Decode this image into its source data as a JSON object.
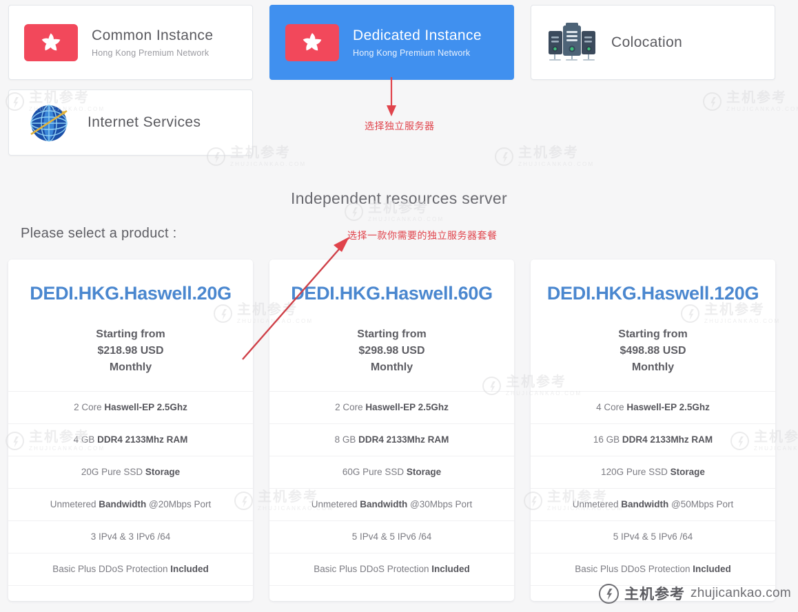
{
  "categories": {
    "row1": [
      {
        "title": "Common Instance",
        "subtitle": "Hong Kong Premium Network",
        "icon": "hong-kong-flag-icon",
        "selected": false
      },
      {
        "title": "Dedicated Instance",
        "subtitle": "Hong Kong Premium Network",
        "icon": "hong-kong-flag-icon",
        "selected": true
      },
      {
        "title": "Colocation",
        "subtitle": "",
        "icon": "server-rack-icon",
        "selected": false
      }
    ],
    "row2": [
      {
        "title": "Internet Services",
        "subtitle": "",
        "icon": "globe-icon",
        "selected": false
      }
    ]
  },
  "annotations": [
    {
      "text": "选择独立服务器",
      "kind": "arrow-down-annotation"
    },
    {
      "text": "选择一款你需要的独立服务器套餐",
      "kind": "arrow-diagonal-annotation"
    }
  ],
  "section_title": "Independent resources server",
  "select_label": "Please select a product :",
  "products": [
    {
      "name": "DEDI.HKG.Haswell.20G",
      "price_prefix": "Starting from",
      "price": "$218.98 USD",
      "price_period": "Monthly",
      "specs": [
        {
          "plain": "2 Core ",
          "bold": "Haswell-EP 2.5Ghz",
          "tail": ""
        },
        {
          "plain": "4 GB ",
          "bold": "DDR4 2133Mhz RAM",
          "tail": ""
        },
        {
          "plain": "20G Pure SSD ",
          "bold": "Storage",
          "tail": ""
        },
        {
          "plain": "Unmetered ",
          "bold": "Bandwidth",
          "tail": " @20Mbps Port"
        },
        {
          "plain": "3 IPv4 & 3 IPv6 /64",
          "bold": "",
          "tail": ""
        },
        {
          "plain": "Basic Plus DDoS Protection ",
          "bold": "Included",
          "tail": ""
        }
      ]
    },
    {
      "name": "DEDI.HKG.Haswell.60G",
      "price_prefix": "Starting from",
      "price": "$298.98 USD",
      "price_period": "Monthly",
      "specs": [
        {
          "plain": "2 Core ",
          "bold": "Haswell-EP 2.5Ghz",
          "tail": ""
        },
        {
          "plain": "8 GB ",
          "bold": "DDR4 2133Mhz RAM",
          "tail": ""
        },
        {
          "plain": "60G Pure SSD ",
          "bold": "Storage",
          "tail": ""
        },
        {
          "plain": "Unmetered ",
          "bold": "Bandwidth",
          "tail": " @30Mbps Port"
        },
        {
          "plain": "5 IPv4 & 5 IPv6 /64",
          "bold": "",
          "tail": ""
        },
        {
          "plain": "Basic Plus DDoS Protection ",
          "bold": "Included",
          "tail": ""
        }
      ]
    },
    {
      "name": "DEDI.HKG.Haswell.120G",
      "price_prefix": "Starting from",
      "price": "$498.88 USD",
      "price_period": "Monthly",
      "specs": [
        {
          "plain": "4 Core ",
          "bold": "Haswell-EP 2.5Ghz",
          "tail": ""
        },
        {
          "plain": "16 GB ",
          "bold": "DDR4 2133Mhz RAM",
          "tail": ""
        },
        {
          "plain": "120G Pure SSD ",
          "bold": "Storage",
          "tail": ""
        },
        {
          "plain": "Unmetered ",
          "bold": "Bandwidth",
          "tail": " @50Mbps Port"
        },
        {
          "plain": "5 IPv4 & 5 IPv6 /64",
          "bold": "",
          "tail": ""
        },
        {
          "plain": "Basic Plus DDoS Protection ",
          "bold": "Included",
          "tail": ""
        }
      ]
    }
  ],
  "watermark": {
    "cn": "主机参考",
    "en": "ZHUJICANKAO.COM",
    "footer_cn": "主机参考",
    "footer_en": "zhujicankao.com"
  },
  "colors": {
    "selected_card": "#4090ef",
    "product_title": "#4a87cf",
    "annotation_red": "#e0434b",
    "flag_red": "#f2485b",
    "page_background": "#f6f6f7"
  }
}
